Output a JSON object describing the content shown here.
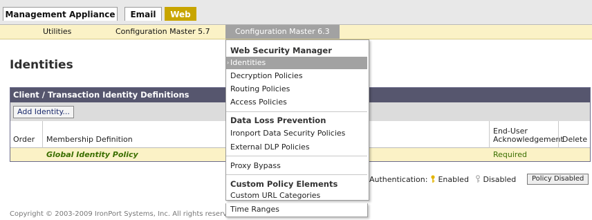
{
  "tabs": [
    {
      "label": "Management Appliance"
    },
    {
      "label": "Email"
    },
    {
      "label": "Web"
    }
  ],
  "subnav": [
    {
      "label": "Utilities"
    },
    {
      "label": "Configuration Master 5.7"
    },
    {
      "label": "Configuration Master 6.3"
    }
  ],
  "page_title": "Identities",
  "panel": {
    "header": "Client / Transaction Identity Definitions",
    "add_button": "Add Identity...",
    "columns": {
      "order": "Order",
      "membership": "Membership Definition",
      "ack_line1": "End-User",
      "ack_line2": "Acknowledgement",
      "delete": "Delete"
    },
    "row": {
      "name": "Global Identity Policy",
      "ack": "Required"
    }
  },
  "legend": {
    "label": "Authentication:",
    "enabled": "Enabled",
    "disabled": "Disabled",
    "policy_button": "Policy Disabled"
  },
  "footer": "Copyright © 2003-2009 IronPort Systems, Inc. All rights reserved.",
  "dropdown": {
    "group1_header": "Web Security Manager",
    "group1_items": [
      "Identities",
      "Decryption Policies",
      "Routing Policies",
      "Access Policies"
    ],
    "group2_header": "Data Loss Prevention",
    "group2_items": [
      "Ironport Data Security Policies",
      "External DLP Policies"
    ],
    "group3_items": [
      "Proxy Bypass"
    ],
    "group4_header": "Custom Policy Elements",
    "group4_items": [
      "Custom URL Categories",
      "Time Ranges"
    ]
  },
  "colors": {
    "accent": "#c8a500",
    "panel_header": "#56566e",
    "highlight": "#fbf2c6",
    "global_policy_text": "#3a6e00"
  }
}
